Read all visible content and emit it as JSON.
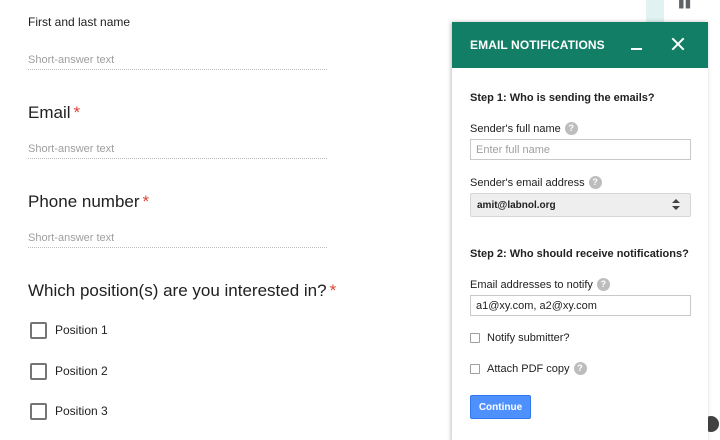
{
  "form": {
    "name_question": "First and last name",
    "name_placeholder": "Short-answer text",
    "email_question": "Email",
    "email_placeholder": "Short-answer text",
    "phone_question": "Phone number",
    "phone_placeholder": "Short-answer text",
    "position_question": "Which position(s) are you interested in?",
    "required_mark": "*",
    "options": [
      "Position 1",
      "Position 2",
      "Position 3"
    ]
  },
  "panel": {
    "title": "EMAIL NOTIFICATIONS",
    "step1": "Step 1: Who is sending the emails?",
    "sender_name_label": "Sender's full name",
    "sender_name_placeholder": "Enter full name",
    "sender_email_label": "Sender's email address",
    "sender_email_value": "amit@labnol.org",
    "step2": "Step 2: Who should receive notifications?",
    "notify_label": "Email addresses to notify",
    "notify_value": "a1@xy.com, a2@xy.com",
    "notify_submitter_label": "Notify submitter?",
    "attach_pdf_label": "Attach PDF copy",
    "continue_label": "Continue",
    "help_glyph": "?"
  },
  "colors": {
    "header_bg": "#127e66",
    "button_bg": "#4d90fe",
    "required": "#db4437"
  },
  "icons": [
    "minimize-icon",
    "close-icon",
    "help-icon",
    "select-arrows-icon"
  ]
}
